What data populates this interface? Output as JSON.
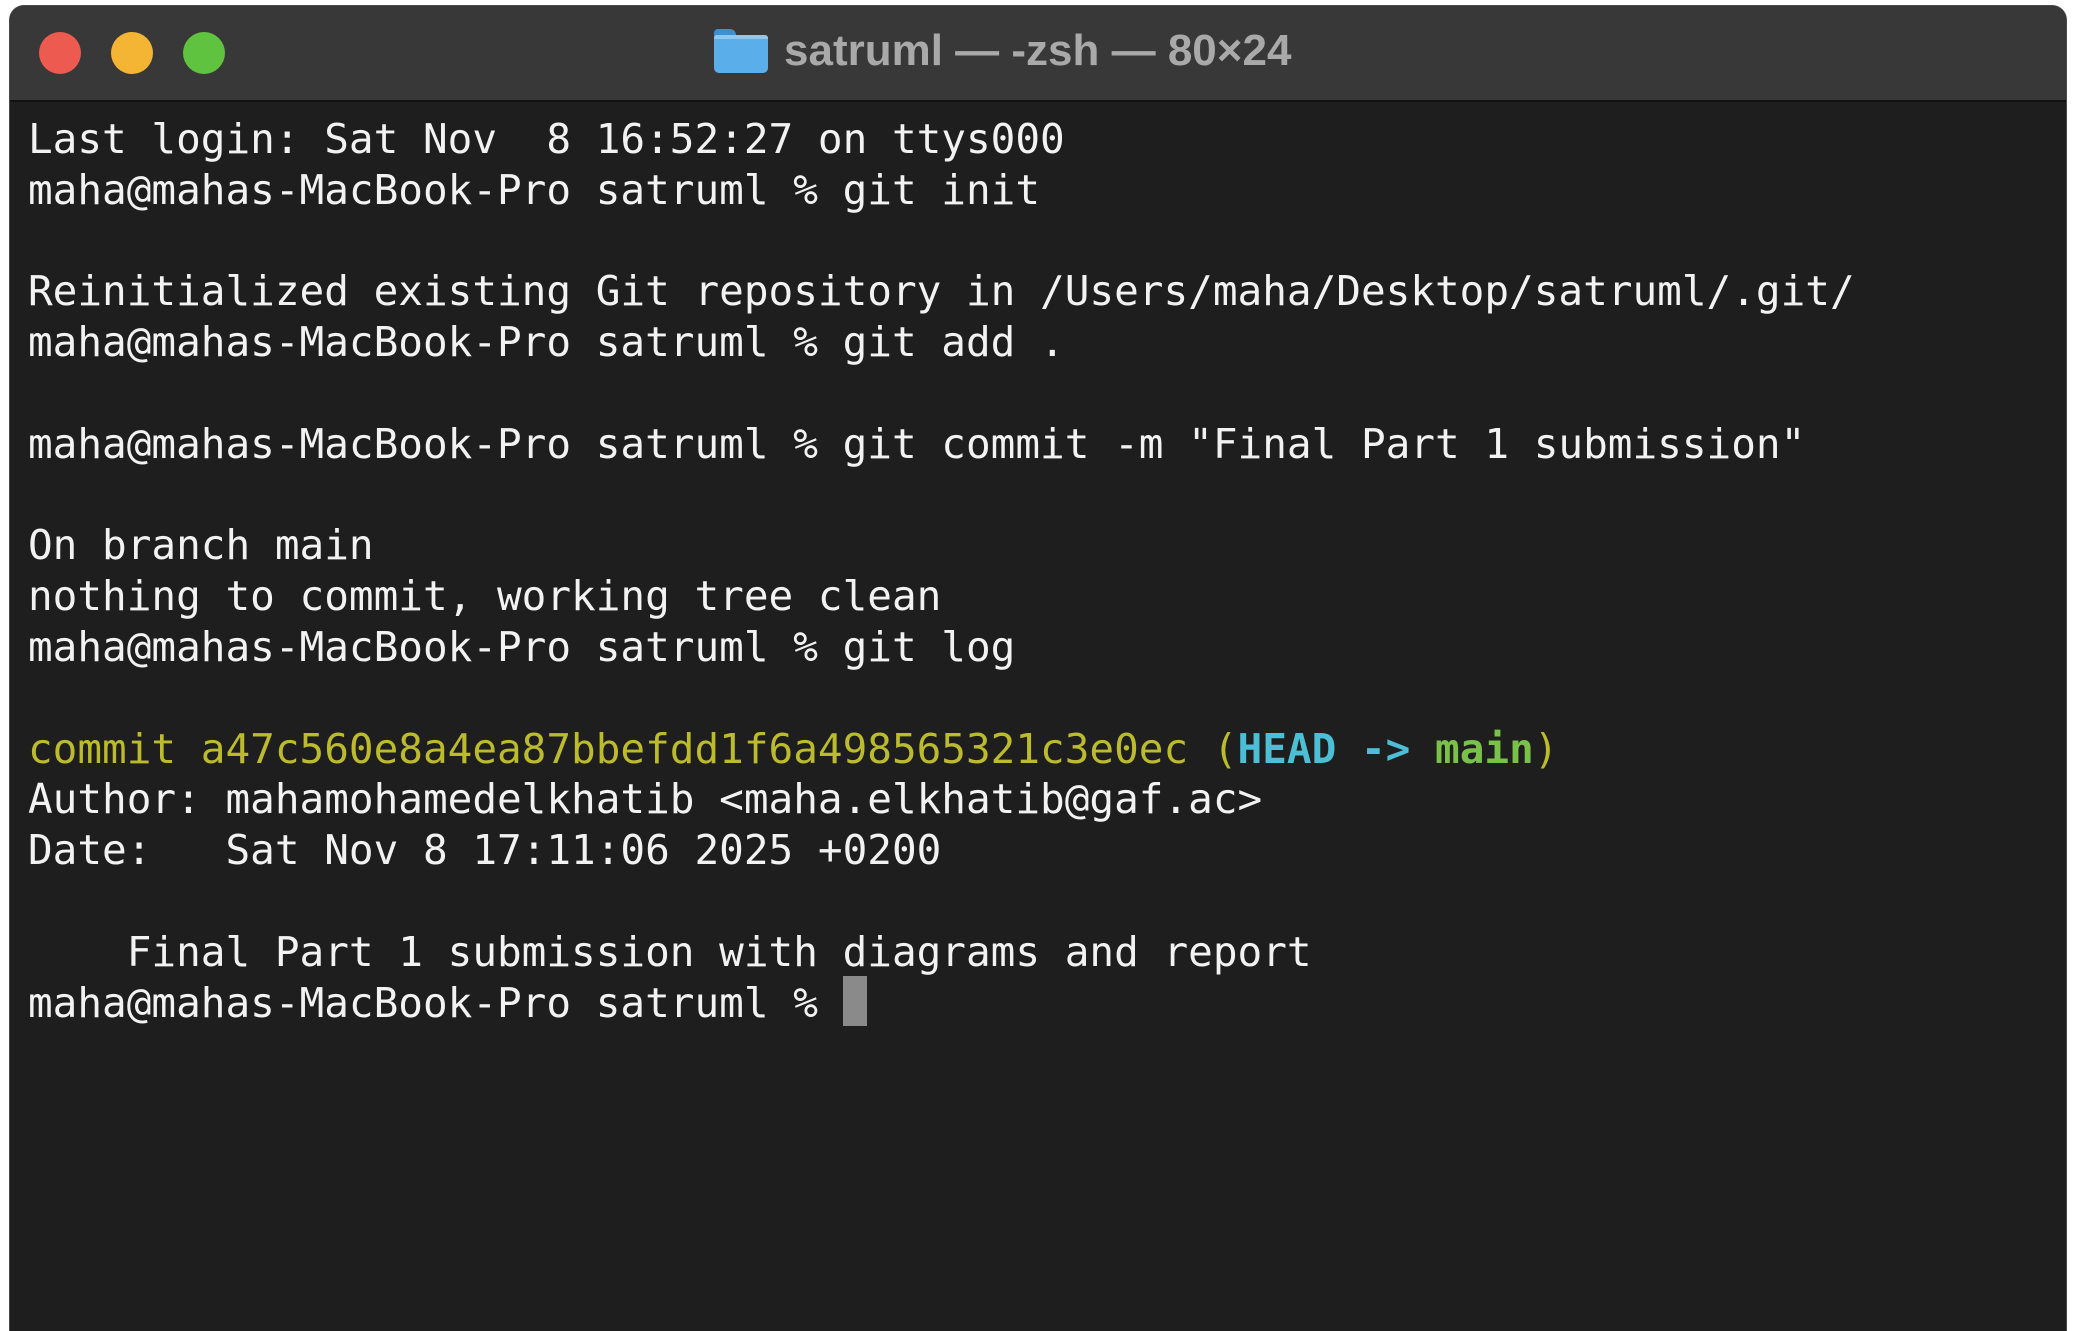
{
  "window": {
    "title": "satruml — -zsh — 80×24"
  },
  "terminal": {
    "lines": [
      "Last login: Sat Nov  8 16:52:27 on ttys000",
      "maha@mahas-MacBook-Pro satruml % git init",
      "",
      "Reinitialized existing Git repository in /Users/maha/Desktop/satruml/.git/",
      "maha@mahas-MacBook-Pro satruml % git add .",
      "",
      "maha@mahas-MacBook-Pro satruml % git commit -m \"Final Part 1 submission\"",
      "",
      "On branch main",
      "nothing to commit, working tree clean",
      "maha@mahas-MacBook-Pro satruml % git log",
      ""
    ],
    "commit": {
      "prefix": "commit a47c560e8a4ea87bbefdd1f6a498565321c3e0ec ",
      "open_paren": "(",
      "head": "HEAD -> ",
      "branch": "main",
      "close_paren": ")"
    },
    "after_lines": [
      "Author: mahamohamedelkhatib <maha.elkhatib@gaf.ac>",
      "Date:   Sat Nov 8 17:11:06 2025 +0200",
      "",
      "    Final Part 1 submission with diagrams and report"
    ],
    "prompt": "maha@mahas-MacBook-Pro satruml % "
  },
  "colors": {
    "background": "#1e1e1e",
    "titlebar": "#383838",
    "text": "#f2f2f2",
    "commit_yellow": "#bbbb2d",
    "head_cyan": "#4cbfd6",
    "branch_green": "#7ac14a",
    "close_button": "#ec5a50",
    "minimize_button": "#f4b534",
    "zoom_button": "#5fc340"
  }
}
